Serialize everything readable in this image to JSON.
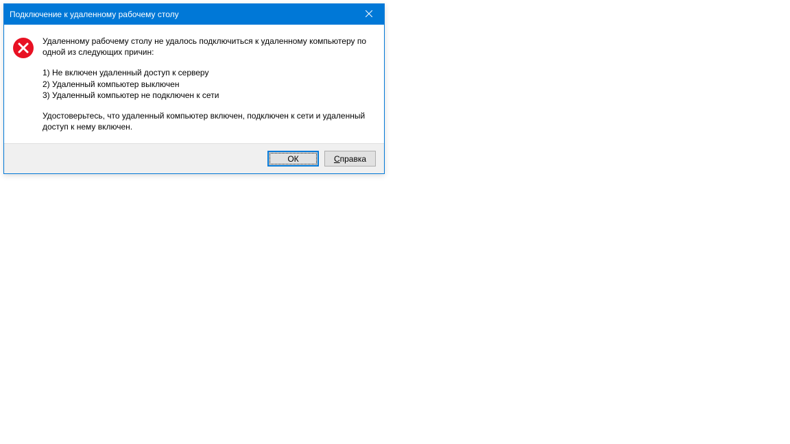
{
  "dialog": {
    "title": "Подключение к удаленному рабочему столу",
    "message_intro": "Удаленному рабочему столу не удалось подключиться к удаленному компьютеру по одной из следующих причин:",
    "reason1": "1) Не включен удаленный доступ к серверу",
    "reason2": "2) Удаленный компьютер выключен",
    "reason3": "3) Удаленный компьютер не подключен к сети",
    "message_footer": "Удостоверьтесь, что удаленный компьютер включен, подключен к сети и удаленный доступ к нему включен.",
    "buttons": {
      "ok": "ОК",
      "help_prefix": "С",
      "help_rest": "правка"
    }
  }
}
